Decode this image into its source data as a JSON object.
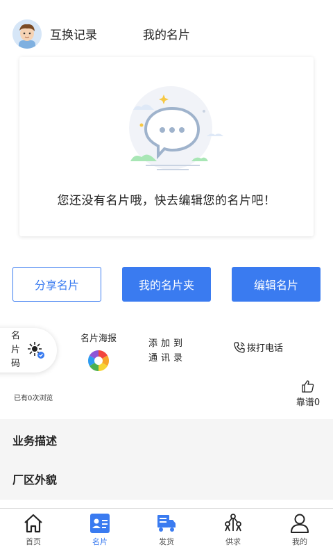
{
  "header": {
    "tabs": [
      {
        "label": "互换记录"
      },
      {
        "label": "我的名片"
      }
    ]
  },
  "empty_state": {
    "message": "您还没有名片哦，快去编辑您的名片吧！"
  },
  "actions": {
    "share_label": "分享名片",
    "folder_label": "我的名片夹",
    "edit_label": "编辑名片"
  },
  "tools": {
    "card_code_label": "名片码",
    "poster_label": "名片海报",
    "contacts_label": "添加到通讯录",
    "call_label": "拨打电话"
  },
  "stats": {
    "views_text": "已有0次浏览",
    "like_text": "靠谱0"
  },
  "sections": [
    {
      "title": "业务描述"
    },
    {
      "title": "厂区外貌"
    }
  ],
  "bottom_nav": [
    {
      "label": "首页",
      "icon": "home-icon"
    },
    {
      "label": "名片",
      "icon": "card-icon",
      "active": true
    },
    {
      "label": "发货",
      "icon": "truck-icon"
    },
    {
      "label": "供求",
      "icon": "network-icon"
    },
    {
      "label": "我的",
      "icon": "user-icon"
    }
  ],
  "colors": {
    "accent": "#3a7bf0",
    "section_bg": "#f5f5f5"
  }
}
